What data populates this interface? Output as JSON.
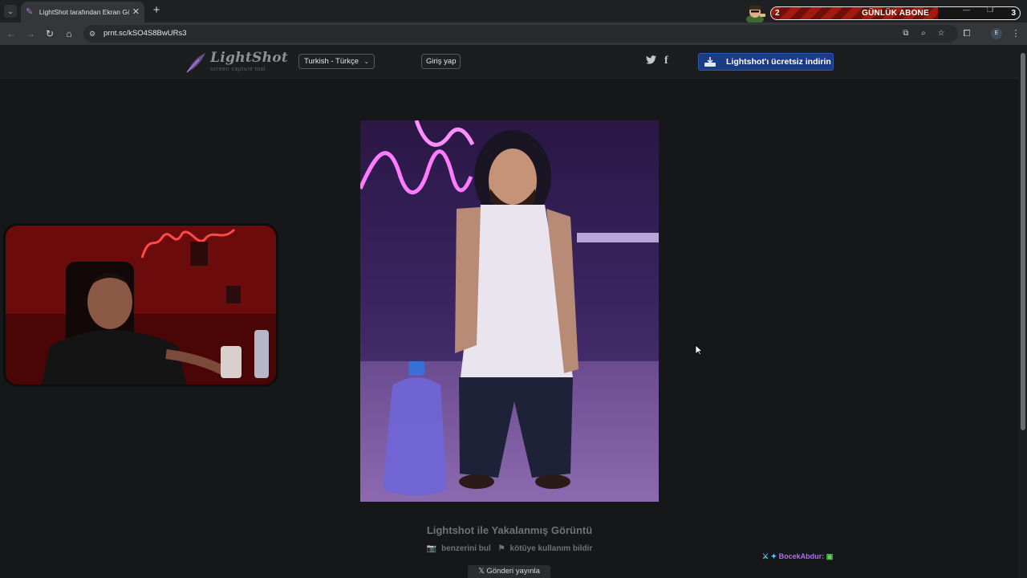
{
  "browser": {
    "tab_title": "LightShot tarafından Ekran Görüntüsü",
    "tab_close": "✕",
    "new_tab": "+",
    "url": "prnt.sc/kSO4S8BwURs3",
    "profile_initial": "E"
  },
  "subscriber_goal": {
    "label": "GÜNLÜK ABONE",
    "current": "2",
    "goal": "3",
    "progress_fraction": 0.67,
    "fill_color": "#a01a12"
  },
  "site": {
    "logo_name": "LightShot",
    "logo_subtitle": "screen capture tool",
    "language": "Turkish - Türkçe",
    "login": "Giriş yap",
    "twitter_icon": "twitter-icon",
    "facebook_icon": "facebook-icon",
    "download_label": "Lightshot'ı ücretsiz indirin",
    "download_color": "#1b3b82"
  },
  "caption": {
    "title": "Lightshot ile Yakalanmış Görüntü",
    "find_similar": "benzerini bul",
    "report_abuse": "kötüye kullanım bildir",
    "tweet": "Gönderi yayınla"
  },
  "chat": {
    "username": "BocekAbdur:"
  }
}
